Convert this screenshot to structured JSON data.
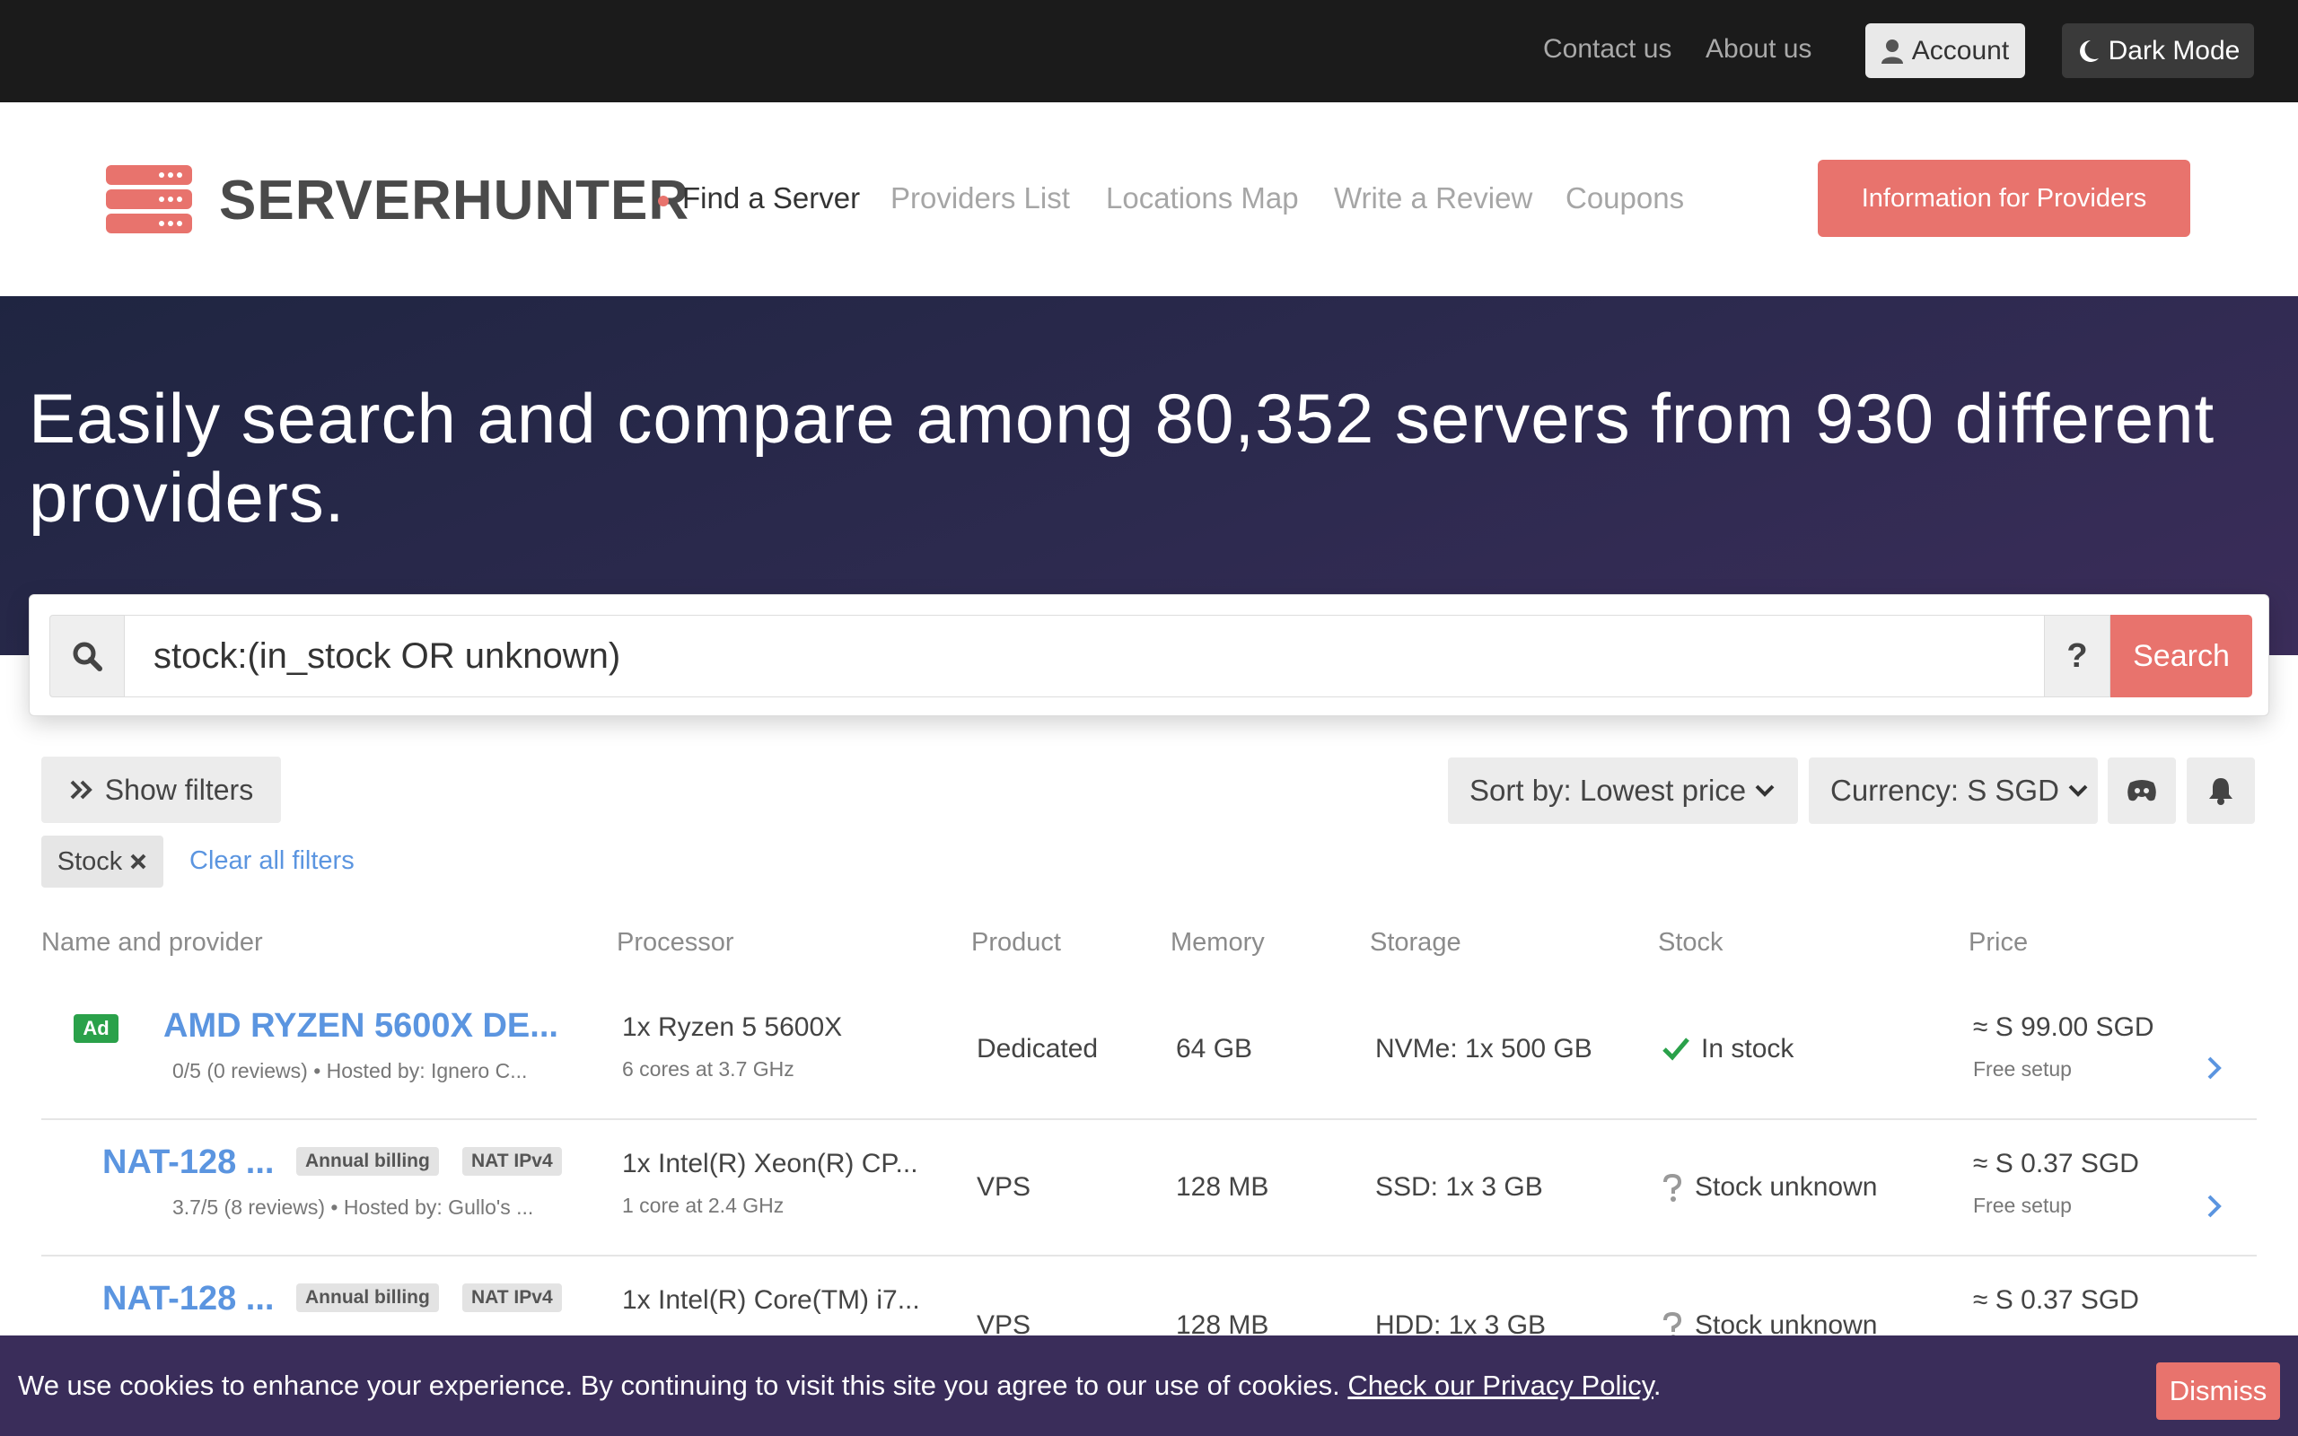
{
  "topbar": {
    "contact": "Contact us",
    "about": "About us",
    "account": "Account",
    "dark_mode": "Dark Mode"
  },
  "header": {
    "brand": "SERVERHUNTER",
    "nav": [
      "Find a Server",
      "Providers List",
      "Locations Map",
      "Write a Review",
      "Coupons"
    ],
    "info_button": "Information for Providers"
  },
  "hero": {
    "title": "Easily search and compare among 80,352 servers from 930 different providers."
  },
  "search": {
    "value": "stock:(in_stock OR unknown)",
    "help": "?",
    "button": "Search"
  },
  "controls": {
    "show_filters": "Show filters",
    "sort": "Sort by: Lowest price",
    "currency": "Currency: S SGD",
    "chip": "Stock",
    "clear": "Clear all filters"
  },
  "table": {
    "headers": [
      "Name and provider",
      "Processor",
      "Product",
      "Memory",
      "Storage",
      "Stock",
      "Price"
    ],
    "rows": [
      {
        "ad": "Ad",
        "name": "AMD RYZEN 5600X DE...",
        "tags": [],
        "meta": "0/5 (0 reviews) • Hosted by: Ignero C...",
        "cpu": "1x Ryzen 5 5600X",
        "cpu_sub": "6 cores at 3.7 GHz",
        "product": "Dedicated",
        "memory": "64 GB",
        "storage": "NVMe: 1x 500 GB",
        "stock": "In stock",
        "price": "≈ S 99.00 SGD",
        "setup": "Free setup"
      },
      {
        "name": "NAT-128 ...",
        "tags": [
          "Annual billing",
          "NAT IPv4"
        ],
        "meta": "3.7/5 (8 reviews) • Hosted by: Gullo's ...",
        "cpu": "1x Intel(R) Xeon(R) CP...",
        "cpu_sub": "1 core at 2.4 GHz",
        "product": "VPS",
        "memory": "128 MB",
        "storage": "SSD: 1x 3 GB",
        "stock": "Stock unknown",
        "price": "≈ S 0.37 SGD",
        "setup": "Free setup"
      },
      {
        "name": "NAT-128 ...",
        "tags": [
          "Annual billing",
          "NAT IPv4"
        ],
        "meta": "",
        "cpu": "1x Intel(R) Core(TM) i7...",
        "cpu_sub": "",
        "product": "VPS",
        "memory": "128 MB",
        "storage": "HDD: 1x 3 GB",
        "stock": "Stock unknown",
        "price": "≈ S 0.37 SGD",
        "setup": ""
      }
    ]
  },
  "cookie": {
    "text": "We use cookies to enhance your experience. By continuing to visit this site you agree to our use of cookies.",
    "link": "Check our Privacy Policy",
    "period": ".",
    "dismiss": "Dismiss"
  },
  "colors": {
    "accent": "#e8736d",
    "link": "#5b95e0",
    "topbar": "#1b1b1b",
    "cookie_bg": "#3a2d5a",
    "stock_ok": "#2aa14a"
  },
  "icons": [
    "user-icon",
    "moon-icon",
    "server-logo-icon",
    "search-icon",
    "chevrons-right-icon",
    "chevron-down-icon",
    "discord-icon",
    "bell-icon",
    "close-icon",
    "check-icon",
    "question-icon",
    "chevron-right-icon"
  ]
}
